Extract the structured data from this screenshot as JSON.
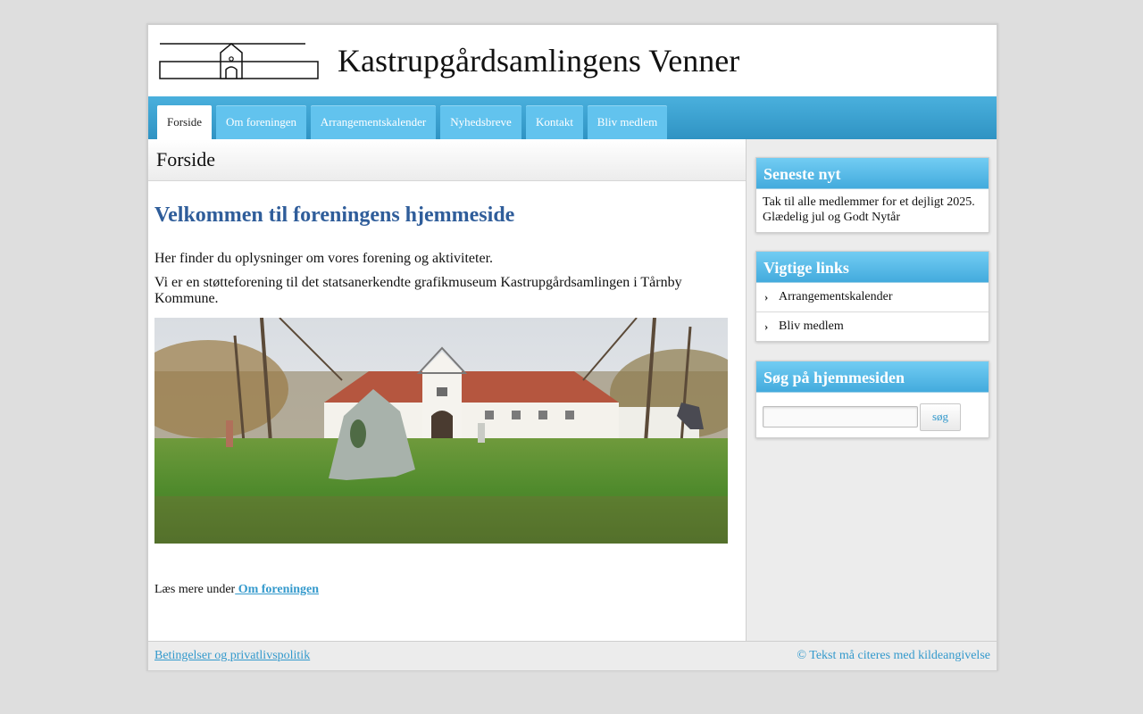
{
  "header": {
    "site_title": "Kastrupgårdsamlingens Venner"
  },
  "nav": {
    "tabs": [
      {
        "label": "Forside",
        "active": true
      },
      {
        "label": "Om foreningen"
      },
      {
        "label": "Arrangementskalender"
      },
      {
        "label": "Nyhedsbreve"
      },
      {
        "label": "Kontakt"
      },
      {
        "label": "Bliv medlem"
      }
    ]
  },
  "main": {
    "page_title": "Forside",
    "heading": "Velkommen til foreningens hjemmeside",
    "paragraph1": "Her finder du oplysninger om vores forening og aktiviteter.",
    "paragraph2": "Vi er en støtteforening til det statsanerkendte grafikmuseum Kastrupgårdsamlingen i Tårnby Kommune.",
    "read_more_prefix": "Læs mere under",
    "read_more_link": " Om foreningen"
  },
  "sidebar": {
    "news": {
      "title": "Seneste nyt",
      "text": "Tak til alle medlemmer for et dejligt 2025. Glædelig jul og Godt Nytår"
    },
    "links": {
      "title": "Vigtige links",
      "items": [
        {
          "label": "Arrangementskalender",
          "icon": "chevron-right-icon"
        },
        {
          "label": "Bliv medlem",
          "icon": "chevron-right-icon"
        }
      ]
    },
    "search": {
      "title": "Søg på hjemmesiden",
      "value": "",
      "button_label": "søg"
    }
  },
  "footer": {
    "left_link": "Betingelser og privatlivspolitik",
    "right_text": "© Tekst må citeres med kildeangivelse"
  },
  "colors": {
    "nav_blue": "#3aa2d1",
    "tab_blue": "#62c3ee",
    "heading_blue": "#2f5d9a",
    "link_blue": "#3399cc"
  }
}
